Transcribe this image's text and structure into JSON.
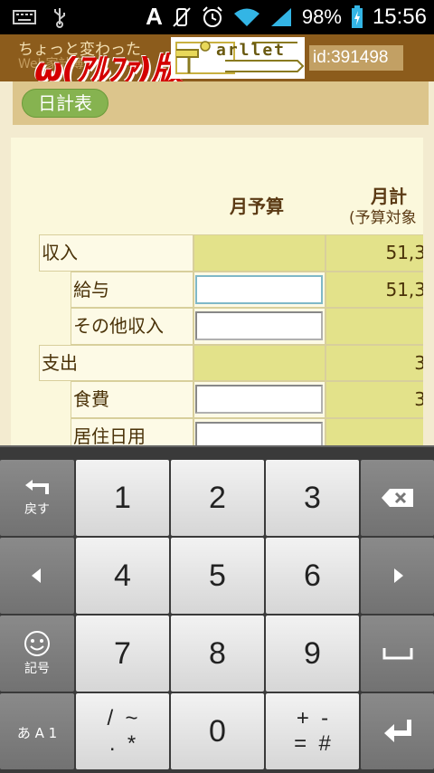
{
  "status": {
    "battery": "98%",
    "time": "15:56",
    "notif_letter": "A"
  },
  "header": {
    "title_line1": "ちょっと変わった",
    "title_line2": "Web家計簿",
    "title_version": "ω(ｱﾙﾌｧ)版",
    "logo_text": "arllet",
    "user_id": "id:391498"
  },
  "tabs": {
    "active": "日計表"
  },
  "table": {
    "col_budget": "月予算",
    "col_total": "月計",
    "col_total_sub": "(予算対象",
    "rows": [
      {
        "label": "収入",
        "indent": false,
        "total": "51,3",
        "input": false
      },
      {
        "label": "給与",
        "indent": true,
        "total": "51,3",
        "input": true
      },
      {
        "label": "その他収入",
        "indent": true,
        "total": "",
        "input": true
      },
      {
        "label": "支出",
        "indent": false,
        "total": "3",
        "input": false
      },
      {
        "label": "食費",
        "indent": true,
        "total": "3",
        "input": true
      },
      {
        "label": "居住日用",
        "indent": true,
        "total": "",
        "input": true
      }
    ]
  },
  "keyboard": {
    "back_label": "戻す",
    "symbol_label": "記号",
    "mode_label": "あ A 1",
    "digits": [
      "1",
      "2",
      "3",
      "4",
      "5",
      "6",
      "7",
      "8",
      "9",
      "0"
    ],
    "sym_left": "/  ~\n.  *",
    "sym_right": "+  -\n=  #"
  },
  "colors": {
    "header_bg": "#8c5c1c",
    "tab_green": "#86b350",
    "budget_yellow": "#e3e28a"
  }
}
